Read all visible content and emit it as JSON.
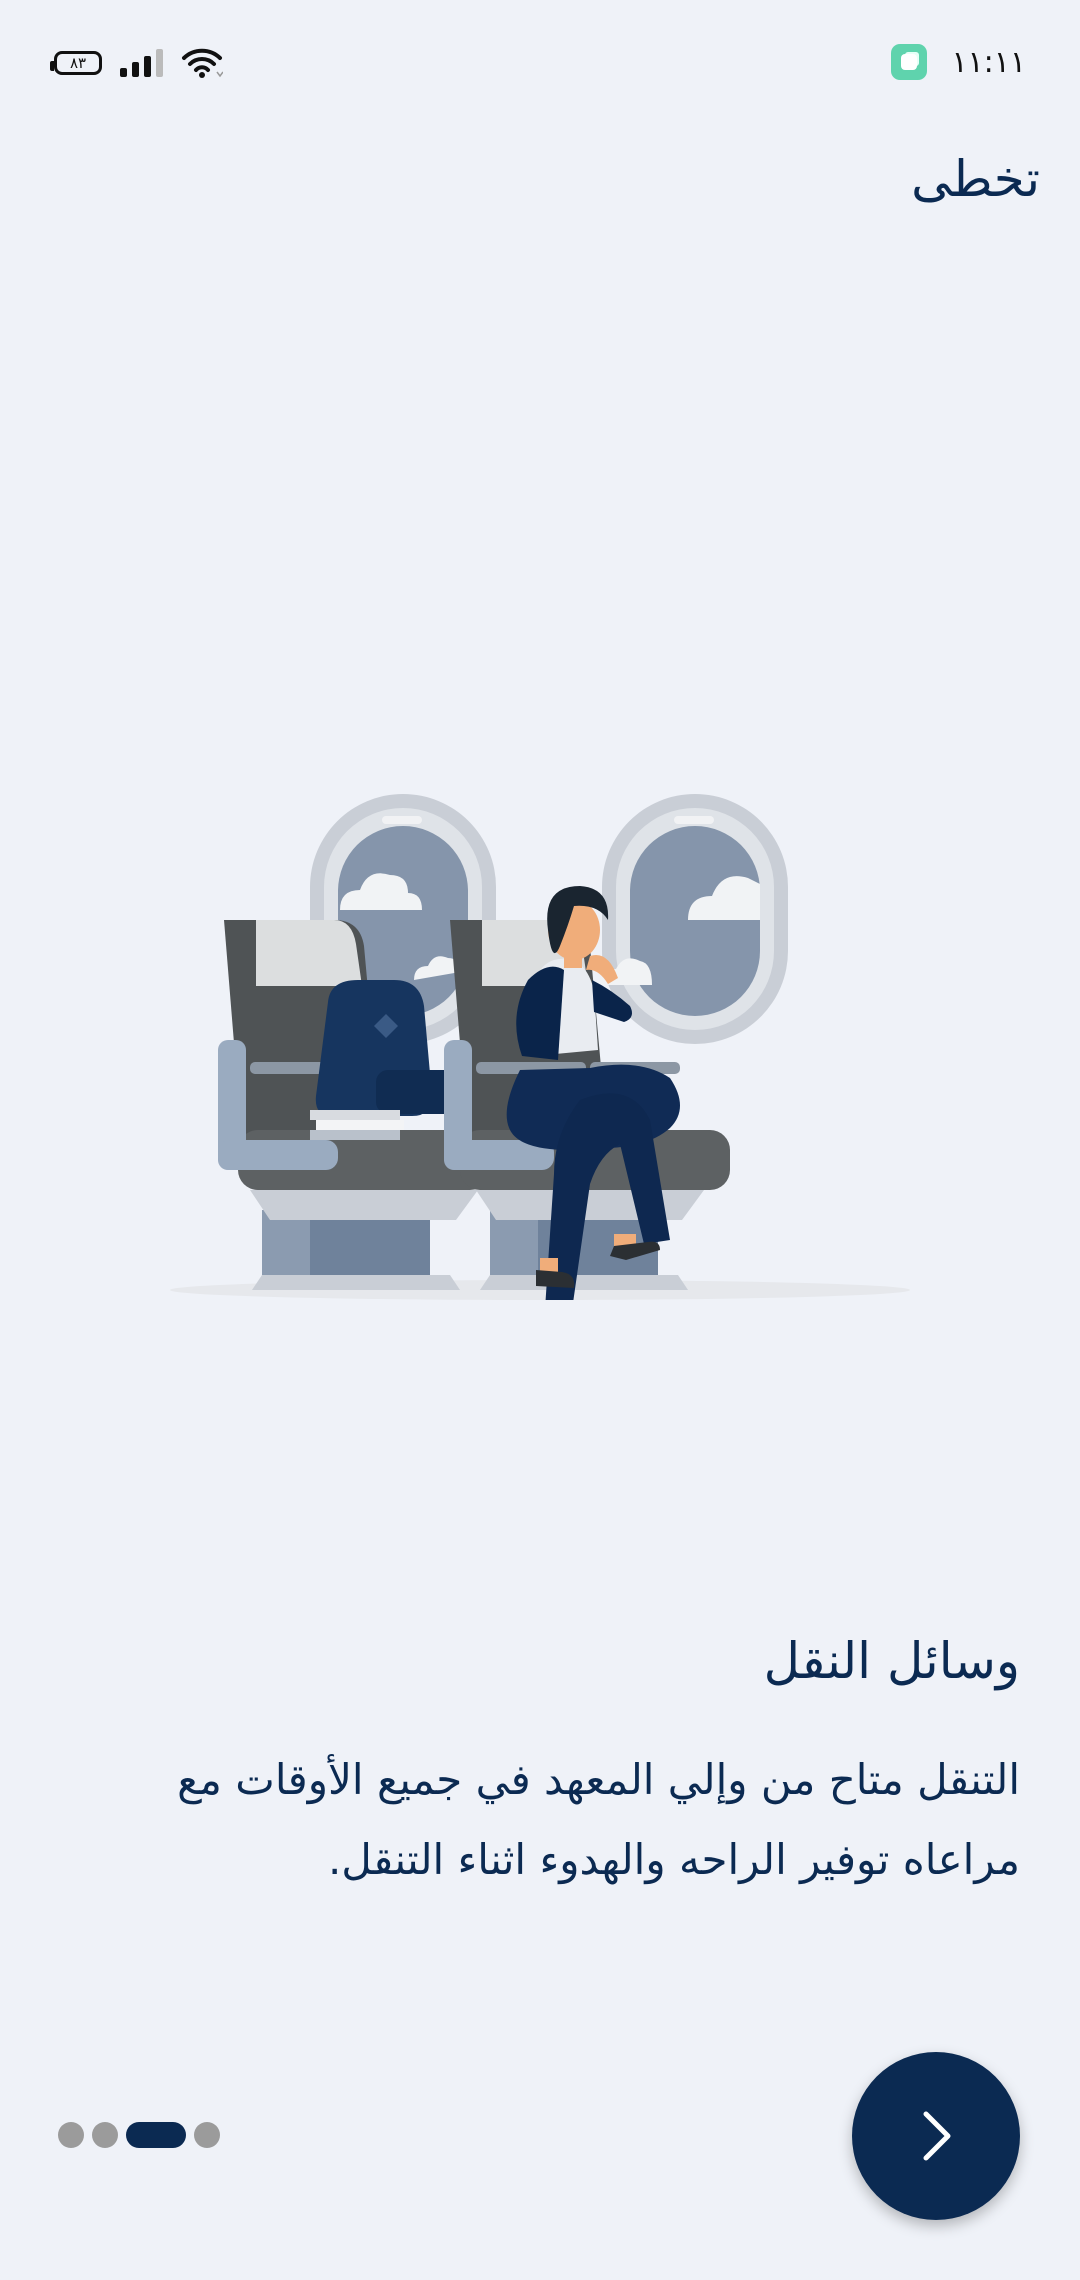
{
  "status_bar": {
    "battery_level": "٨٣",
    "time": "١١:١١"
  },
  "skip_label": "تخطى",
  "onboarding": {
    "title": "وسائل النقل",
    "description": "التنقل متاح من وإلي المعهد في جميع الأوقات مع مراعاه توفير الراحه والهدوء اثناء التنقل.",
    "page_count": 4,
    "active_index": 2
  },
  "colors": {
    "primary": "#0b2a52",
    "background": "#eff2f8",
    "dot_inactive": "#9b9b9b"
  },
  "icons": {
    "next": "chevron-right-icon",
    "wifi": "wifi-icon",
    "signal": "signal-icon",
    "battery": "battery-icon"
  }
}
